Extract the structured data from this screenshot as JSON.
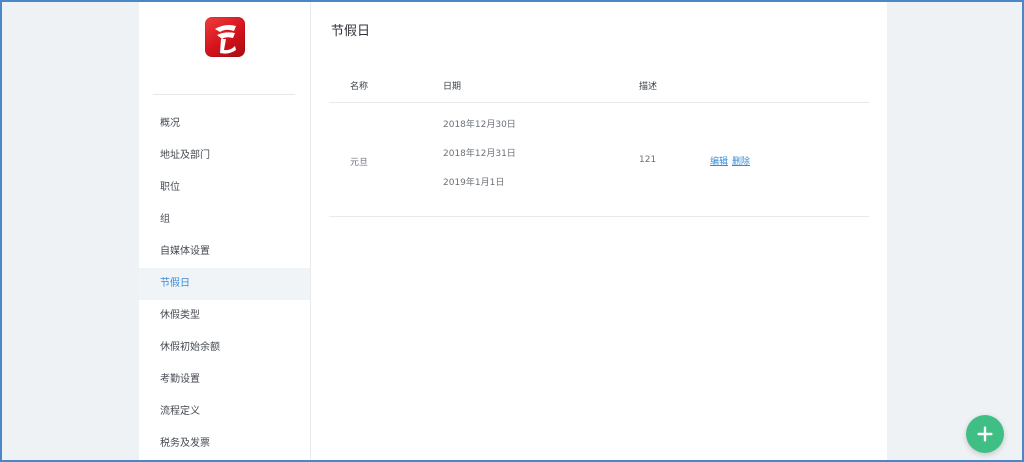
{
  "sidebar": {
    "logo": {
      "name": "brand-logo",
      "color": "#d4121b"
    },
    "items": [
      {
        "label": "概况",
        "active": false
      },
      {
        "label": "地址及部门",
        "active": false
      },
      {
        "label": "职位",
        "active": false
      },
      {
        "label": "组",
        "active": false
      },
      {
        "label": "自媒体设置",
        "active": false
      },
      {
        "label": "节假日",
        "active": true
      },
      {
        "label": "休假类型",
        "active": false
      },
      {
        "label": "休假初始余额",
        "active": false
      },
      {
        "label": "考勤设置",
        "active": false
      },
      {
        "label": "流程定义",
        "active": false
      },
      {
        "label": "税务及发票",
        "active": false
      }
    ]
  },
  "main": {
    "title": "节假日",
    "table": {
      "headers": {
        "name": "名称",
        "date": "日期",
        "desc": "描述"
      },
      "rows": [
        {
          "name": "元旦",
          "dates": [
            "2018年12月30日",
            "2018年12月31日",
            "2019年1月1日"
          ],
          "desc": "121",
          "edit_label": "编辑",
          "delete_label": "删除"
        }
      ]
    }
  },
  "fab": {
    "icon": "plus-icon",
    "color": "#3fbf84"
  },
  "colors": {
    "accent": "#3c8bd9",
    "frame": "#4a86c8",
    "background": "#eff2f4"
  }
}
